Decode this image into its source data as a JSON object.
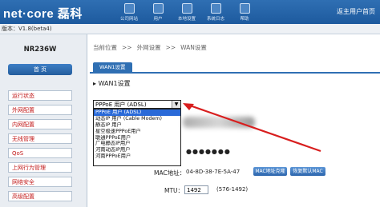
{
  "header": {
    "logo": "net·core 磊科",
    "nav": [
      "公司网站",
      "用户",
      "本地设置",
      "系统日志",
      "帮助"
    ],
    "right_text": "返主用户首页"
  },
  "version": "版本：V1.8(beta4)",
  "sidebar": {
    "model": "NR236W",
    "home": "首  页",
    "items": [
      "运行状态",
      "外网配置",
      "内网配置",
      "无线管理",
      "QoS",
      "上网行为管理",
      "网络安全",
      "高级配置"
    ]
  },
  "breadcrumb": [
    "当前位置",
    ">>",
    "外网设置",
    ">>",
    "WAN设置"
  ],
  "tab": "WAN1设置",
  "section_title": "WAN1设置",
  "connection_select": {
    "value": "PPPoE 用户 (ADSL)",
    "options": [
      "PPPoE 用户 (ADSL)",
      "动态IP 用户 (Cable Modem)",
      "静态IP 用户",
      "星空极速PPPoE用户",
      "联通PPPoE用户",
      "广电静态IP用户",
      "河南动态IP用户",
      "河南PPPoE用户"
    ]
  },
  "password_mask": "●●●●●●●",
  "mac": {
    "label": "MAC地址：",
    "value": "04-8D-38-7E-5A-47",
    "clone_button": "MAC地址克隆",
    "restore_button": "恢复默认MAC"
  },
  "mtu": {
    "label": "MTU：",
    "value": "1492",
    "hint": "(576-1492)"
  }
}
